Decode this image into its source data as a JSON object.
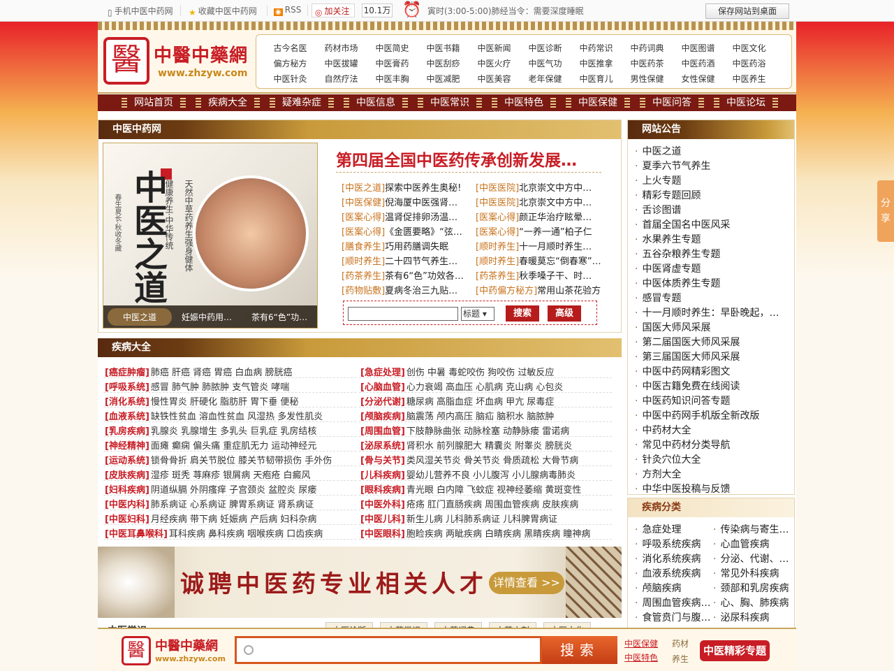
{
  "topbar": {
    "mobile": "手机中医中药网",
    "favorite": "收藏中医中药网",
    "rss": "RSS",
    "follow": "加关注",
    "follow_count": "10.1万",
    "tip": "寅时(3:00-5:00)肺经当令：需要深度睡眠",
    "save_desktop": "保存网站到桌面"
  },
  "logo": {
    "name": "中醫中藥網",
    "url": "www.zhzyw.com",
    "mark": "醫"
  },
  "topnav": [
    [
      "古今名医",
      "药材市场",
      "中医简史",
      "中医书籍",
      "中医新闻",
      "中医诊断",
      "中药常识",
      "中药词典",
      "中医图谱",
      "中医文化"
    ],
    [
      "偏方秘方",
      "中医拔罐",
      "中医膏药",
      "中医刮痧",
      "中医火疗",
      "中医气功",
      "中医推拿",
      "中医药茶",
      "中医药酒",
      "中医药浴"
    ],
    [
      "中医针灸",
      "自然疗法",
      "中医丰胸",
      "中医减肥",
      "中医美容",
      "老年保健",
      "中医育儿",
      "男性保健",
      "女性保健",
      "中医养生"
    ]
  ],
  "mainnav": [
    "网站首页",
    "疾病大全",
    "疑难杂症",
    "中医信息",
    "中医常识",
    "中医特色",
    "中医保健",
    "中医问答",
    "中医论坛"
  ],
  "section_main": {
    "title": "中医中药网",
    "feature": {
      "big_text": "中医之道",
      "vtext1": "健康养生·中华传统",
      "vtext2": "天然中草药养生强身健体",
      "vtext3": "春生夏长·秋收冬藏",
      "tabs": [
        "中医之道",
        "妊娠中药用…",
        "茶有6“色”功…"
      ]
    },
    "headline": "第四届全国中医药传承创新发展…",
    "news_left": [
      {
        "cat": "[中医之道]",
        "title": "探索中医养生奥秘!"
      },
      {
        "cat": "[中医保健]",
        "title": "倪海厦中医强肾…"
      },
      {
        "cat": "[医案心得]",
        "title": "温肾促排卵汤温…"
      },
      {
        "cat": "[医案心得]",
        "title": "《金匮要略》“弦…"
      },
      {
        "cat": "[膳食养生]",
        "title": "巧用药膳调失眠"
      },
      {
        "cat": "[顺时养生]",
        "title": "二十四节气养生…"
      },
      {
        "cat": "[药茶养生]",
        "title": "茶有6“色”功效各…"
      },
      {
        "cat": "[药物贴敷]",
        "title": "夏病冬治三九贴…"
      }
    ],
    "news_right": [
      {
        "cat": "[中医医院]",
        "title": "北京崇文中方中…"
      },
      {
        "cat": "[中医医院]",
        "title": "北京崇文中方中…"
      },
      {
        "cat": "[医案心得]",
        "title": "颜正华治疗眩晕…"
      },
      {
        "cat": "[医案心得]",
        "title": "“一养一通”柏子仁"
      },
      {
        "cat": "[顺时养生]",
        "title": "十一月顺时养生…"
      },
      {
        "cat": "[顺时养生]",
        "title": "春暖莫忘“倒春寒”…"
      },
      {
        "cat": "[药茶养生]",
        "title": "秋季嗓子干、时…"
      },
      {
        "cat": "[中药偏方秘方]",
        "title": "常用山茶花验方"
      }
    ],
    "search": {
      "select": "标题",
      "btn_search": "搜索",
      "btn_advanced": "高级"
    }
  },
  "section_disease": {
    "title": "疾病大全",
    "left": [
      {
        "k": "[癌症肿瘤]",
        "v": "肺癌 肝癌 肾癌 胃癌 白血病 膀胱癌"
      },
      {
        "k": "[呼吸系统]",
        "v": "感冒 肺气肿 肺脓肿 支气管炎 哮喘"
      },
      {
        "k": "[消化系统]",
        "v": "慢性胃炎 肝硬化 脂肪肝 胃下垂 便秘"
      },
      {
        "k": "[血液系统]",
        "v": "缺铁性贫血 溶血性贫血 风湿热 多发性肌炎"
      },
      {
        "k": "[乳房疾病]",
        "v": "乳腺炎 乳腺增生 多乳头 巨乳症 乳房结核"
      },
      {
        "k": "[神经精神]",
        "v": "面瘫 癫痫 偏头痛 重症肌无力 运动神经元"
      },
      {
        "k": "[运动系统]",
        "v": "锁骨骨折 肩关节脱位 膝关节韧带损伤 手外伤"
      },
      {
        "k": "[皮肤疾病]",
        "v": "湿疹 斑秃 荨麻疹 银屑病 天疱疮 白癜风"
      },
      {
        "k": "[妇科疾病]",
        "v": "阴道纵膈 外阴瘙痒 子宫颈炎 盆腔炎 尿瘘"
      },
      {
        "k": "[中医内科]",
        "v": "肺系病证 心系病证 脾胃系病证 肾系病证"
      },
      {
        "k": "[中医妇科]",
        "v": "月经疾病 带下病 妊娠病 产后病 妇科杂病"
      },
      {
        "k": "[中医耳鼻喉科]",
        "v": "耳科疾病 鼻科疾病 咽喉疾病 口齿疾病"
      }
    ],
    "right": [
      {
        "k": "[急症处理]",
        "v": "创伤 中暑 毒蛇咬伤 狗咬伤 过敏反应"
      },
      {
        "k": "[心脑血管]",
        "v": "心力衰竭 高血压 心肌病 克山病 心包炎"
      },
      {
        "k": "[分泌代谢]",
        "v": "糖尿病 高脂血症 坏血病 甲亢 尿毒症"
      },
      {
        "k": "[颅脑疾病]",
        "v": "脑震荡 颅内高压 脑疝 脑积水 脑脓肿"
      },
      {
        "k": "[周围血管]",
        "v": "下肢静脉曲张 动脉栓塞 动静脉瘘 雷诺病"
      },
      {
        "k": "[泌尿系统]",
        "v": "肾积水 前列腺肥大 精囊炎 附睾炎 膀胱炎"
      },
      {
        "k": "[骨与关节]",
        "v": "类风湿关节炎 骨关节炎 骨质疏松 大骨节病"
      },
      {
        "k": "[儿科疾病]",
        "v": "婴幼儿营养不良 小儿腹泻 小儿腺病毒肺炎"
      },
      {
        "k": "[眼科疾病]",
        "v": "青光眼 白内障 飞蚊症 视神经萎缩 黄斑变性"
      },
      {
        "k": "[中医外科]",
        "v": "疮疡 肛门直肠疾病 周围血管疾病 皮肤疾病"
      },
      {
        "k": "[中医儿科]",
        "v": "新生儿病 儿科肺系病证 儿科脾胃病证"
      },
      {
        "k": "[中医眼科]",
        "v": "胞睑疾病 两眦疾病 白睛疾病 黑睛疾病 瞳神病"
      }
    ]
  },
  "banner": {
    "text": "诚聘中医药专业相关人才",
    "more": "详情查看 >>"
  },
  "tabs2": {
    "label": "中医常识",
    "items": [
      "中医诊断",
      "中药常识",
      "中药词典",
      "中药方剂",
      "中医文化"
    ]
  },
  "notice": {
    "title": "网站公告",
    "items": [
      "中医之道",
      "夏季六节气养生",
      "上火专题",
      "精彩专题回顾",
      "舌诊图谱",
      "首届全国名中医风采",
      "水果养生专题",
      "五谷杂粮养生专题",
      "中医肾虚专题",
      "中医体质养生专题",
      "感冒专题",
      "十一月顺时养生：早卧晚起，…",
      "国医大师风采展",
      "第二届国医大师风采展",
      "第三届国医大师风采展",
      "中医中药网精彩图文",
      "中医古籍免费在线阅读",
      "中医药知识问答专题",
      "中医中药网手机版全新改版",
      "中药材大全",
      "常见中药材分类导航",
      "针灸穴位大全",
      "方剂大全",
      "中华中医投稿与反馈"
    ]
  },
  "disease_cat": {
    "title": "疾病分类",
    "left": [
      "急症处理",
      "呼吸系统疾病",
      "消化系统疾病",
      "血液系统疾病",
      "颅脑疾病",
      "周围血管疾病…",
      "食管贲门与腹…"
    ],
    "right": [
      "传染病与寄生…",
      "心血管疾病",
      "分泌、代谢、…",
      "常见外科疾病",
      "颈部和乳房疾病",
      "心、胸、肺疾病",
      "泌尿科疾病"
    ]
  },
  "share": "分享",
  "bottombar": {
    "name": "中醫中藥網",
    "url": "www.zhzyw.com",
    "mark": "醫",
    "search_btn": "搜索",
    "link1": "中医保健",
    "link2": "中医特色",
    "link3": "药材",
    "link4": "养生",
    "special": "中医精彩专题"
  }
}
